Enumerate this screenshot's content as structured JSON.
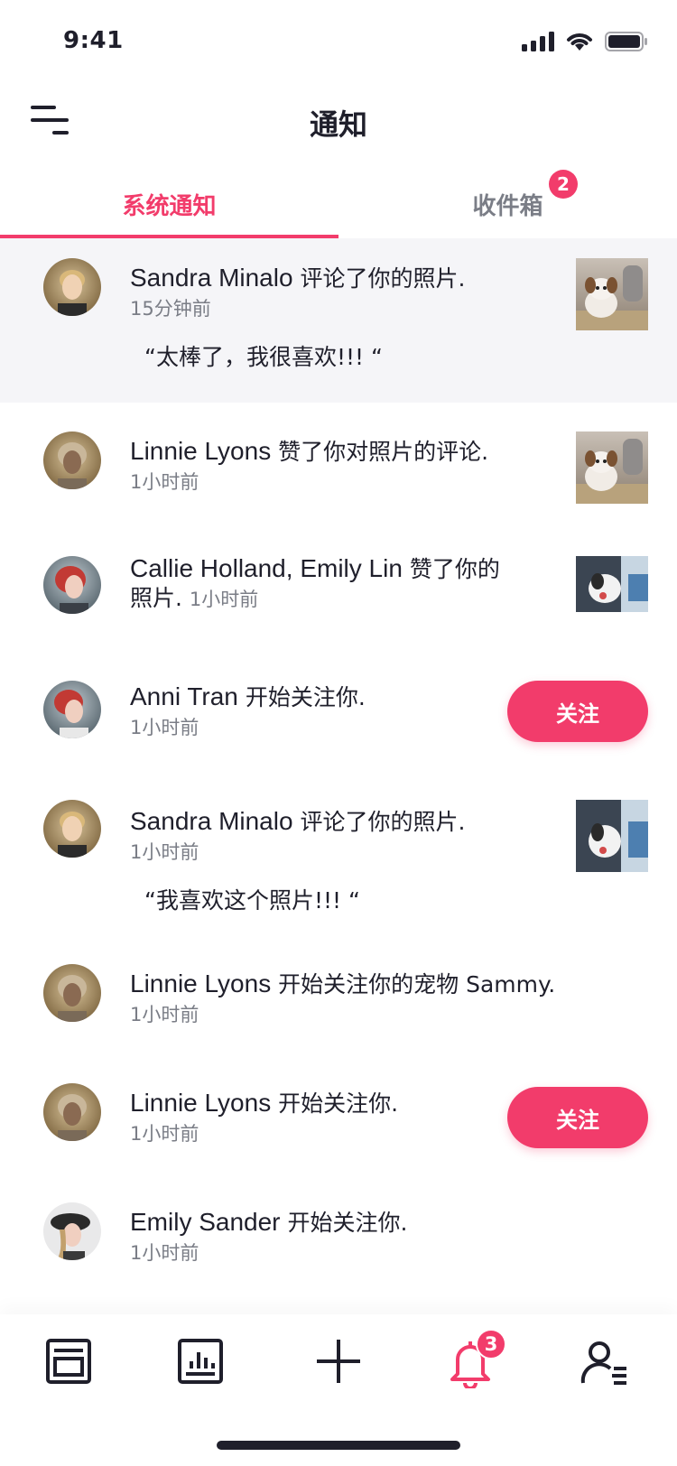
{
  "status": {
    "time": "9:41"
  },
  "header": {
    "title": "通知"
  },
  "tabs": [
    {
      "label": "系统通知",
      "active": true
    },
    {
      "label": "收件箱",
      "badge": "2"
    }
  ],
  "notifications": [
    {
      "name": "Sandra Minalo",
      "action": "评论了你的照片.",
      "time": "15分钟前",
      "quote": "“太棒了，我很喜欢!!! “",
      "thumb": "puppy-photo"
    },
    {
      "name": "Linnie Lyons",
      "action": "赞了你对照片的评论.",
      "time": "1小时前",
      "thumb": "puppy-photo"
    },
    {
      "name": "Callie Holland, Emily Lin",
      "action_line1": "赞了你的",
      "action_line2": "照片.",
      "time": "1小时前",
      "thumb": "puppy-lap-photo"
    },
    {
      "name": "Anni Tran",
      "action": "开始关注你.",
      "time": "1小时前",
      "button": "关注"
    },
    {
      "name": "Sandra Minalo",
      "action": "评论了你的照片.",
      "time": "1小时前",
      "quote": "“我喜欢这个照片!!! “",
      "thumb": "puppy-lap-photo"
    },
    {
      "name": "Linnie Lyons",
      "action": "开始关注你的宠物 Sammy.",
      "time": "1小时前"
    },
    {
      "name": "Linnie Lyons",
      "action": "开始关注你.",
      "time": "1小时前",
      "button": "关注"
    },
    {
      "name": "Emily Sander",
      "action": "开始关注你.",
      "time": "1小时前"
    }
  ],
  "nav": {
    "notifications_badge": "3"
  },
  "colors": {
    "accent": "#f23c6b",
    "text": "#1f1f2b",
    "muted": "#7a7d86",
    "highlight": "#f5f5f8"
  },
  "icons": [
    "wifi-icon",
    "battery-icon",
    "signal-icon",
    "menu-icon",
    "feed-icon",
    "chart-icon",
    "plus-icon",
    "bell-icon",
    "profile-icon"
  ]
}
